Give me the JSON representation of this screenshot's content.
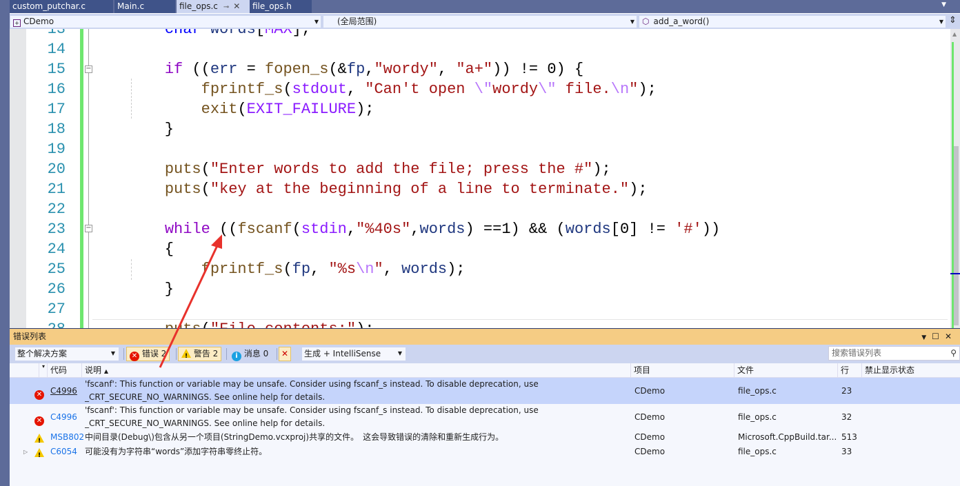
{
  "tabs": [
    {
      "label": "custom_putchar.c"
    },
    {
      "label": "Main.c"
    },
    {
      "label": "file_ops.c",
      "active": true
    },
    {
      "label": "file_ops.h"
    }
  ],
  "nav": {
    "project": "CDemo",
    "scope": "(全局范围)",
    "function": "add_a_word()"
  },
  "code": [
    {
      "n": "13",
      "t": [
        [
          "    ",
          "pl"
        ],
        [
          "char",
          "ty"
        ],
        [
          " ",
          "pl"
        ],
        [
          "words",
          "var"
        ],
        [
          "[",
          "pl"
        ],
        [
          "MAX",
          "mac"
        ],
        [
          "];",
          "pl"
        ]
      ]
    },
    {
      "n": "14",
      "t": []
    },
    {
      "n": "15",
      "t": [
        [
          "    ",
          "pl"
        ],
        [
          "if",
          "kw"
        ],
        [
          " ((",
          "pl"
        ],
        [
          "err",
          "var"
        ],
        [
          " = ",
          "pl"
        ],
        [
          "fopen_s",
          "fn"
        ],
        [
          "(&",
          "pl"
        ],
        [
          "fp",
          "var"
        ],
        [
          ",",
          "pl"
        ],
        [
          "\"wordy\"",
          "str"
        ],
        [
          ", ",
          "pl"
        ],
        [
          "\"a+\"",
          "str"
        ],
        [
          ")) != 0) {",
          "pl"
        ]
      ]
    },
    {
      "n": "16",
      "t": [
        [
          "        ",
          "pl"
        ],
        [
          "fprintf_s",
          "fn"
        ],
        [
          "(",
          "pl"
        ],
        [
          "stdout",
          "mac"
        ],
        [
          ", ",
          "pl"
        ],
        [
          "\"Can't open ",
          "str"
        ],
        [
          "\\\"",
          "esc"
        ],
        [
          "wordy",
          "str"
        ],
        [
          "\\\"",
          "esc"
        ],
        [
          " file.",
          "str"
        ],
        [
          "\\n",
          "esc"
        ],
        [
          "\"",
          "str"
        ],
        [
          ");",
          "pl"
        ]
      ]
    },
    {
      "n": "17",
      "t": [
        [
          "        ",
          "pl"
        ],
        [
          "exit",
          "fn"
        ],
        [
          "(",
          "pl"
        ],
        [
          "EXIT_FAILURE",
          "mac"
        ],
        [
          ");",
          "pl"
        ]
      ]
    },
    {
      "n": "18",
      "t": [
        [
          "    }",
          "pl"
        ]
      ]
    },
    {
      "n": "19",
      "t": []
    },
    {
      "n": "20",
      "t": [
        [
          "    ",
          "pl"
        ],
        [
          "puts",
          "fn"
        ],
        [
          "(",
          "pl"
        ],
        [
          "\"Enter words to add the file; press the #\"",
          "str"
        ],
        [
          ");",
          "pl"
        ]
      ]
    },
    {
      "n": "21",
      "t": [
        [
          "    ",
          "pl"
        ],
        [
          "puts",
          "fn"
        ],
        [
          "(",
          "pl"
        ],
        [
          "\"key at the beginning of a line to terminate.\"",
          "str"
        ],
        [
          ");",
          "pl"
        ]
      ]
    },
    {
      "n": "22",
      "t": []
    },
    {
      "n": "23",
      "t": [
        [
          "    ",
          "pl"
        ],
        [
          "while",
          "kw"
        ],
        [
          " ((",
          "pl"
        ],
        [
          "fscanf",
          "fn"
        ],
        [
          "(",
          "pl"
        ],
        [
          "stdin",
          "mac"
        ],
        [
          ",",
          "pl"
        ],
        [
          "\"%40s\"",
          "str"
        ],
        [
          ",",
          "pl"
        ],
        [
          "words",
          "var"
        ],
        [
          ") ==1) && (",
          "pl"
        ],
        [
          "words",
          "var"
        ],
        [
          "[0] != ",
          "pl"
        ],
        [
          "'#'",
          "str"
        ],
        [
          "))",
          "pl"
        ]
      ]
    },
    {
      "n": "24",
      "t": [
        [
          "    {",
          "pl"
        ]
      ]
    },
    {
      "n": "25",
      "t": [
        [
          "        ",
          "pl"
        ],
        [
          "fprintf_s",
          "fn"
        ],
        [
          "(",
          "pl"
        ],
        [
          "fp",
          "var"
        ],
        [
          ", ",
          "pl"
        ],
        [
          "\"%s",
          "str"
        ],
        [
          "\\n",
          "esc"
        ],
        [
          "\"",
          "str"
        ],
        [
          ", ",
          "pl"
        ],
        [
          "words",
          "var"
        ],
        [
          ");",
          "pl"
        ]
      ]
    },
    {
      "n": "26",
      "t": [
        [
          "    }",
          "pl"
        ]
      ]
    },
    {
      "n": "27",
      "t": []
    },
    {
      "n": "28",
      "t": [
        [
          "    ",
          "pl"
        ],
        [
          "puts",
          "fn"
        ],
        [
          "(",
          "pl"
        ],
        [
          "\"File contents:\"",
          "str"
        ],
        [
          ");",
          "pl"
        ]
      ]
    }
  ],
  "error_list": {
    "title": "错误列表",
    "scope": "整个解决方案",
    "errors": "错误 2",
    "warnings": "警告 2",
    "messages": "消息 0",
    "source": "生成 + IntelliSense",
    "search_placeholder": "搜索错误列表",
    "columns": {
      "code": "代码",
      "desc": "说明",
      "project": "项目",
      "file": "文件",
      "line": "行",
      "suppress": "禁止显示状态"
    },
    "rows": [
      {
        "severity": "error",
        "code": "C4996",
        "desc1": "'fscanf': This function or variable may be unsafe. Consider using fscanf_s instead. To disable deprecation, use",
        "desc2": "_CRT_SECURE_NO_WARNINGS. See online help for details.",
        "project": "CDemo",
        "file": "file_ops.c",
        "line": "23",
        "selected": true
      },
      {
        "severity": "error",
        "code": "C4996",
        "desc1": "'fscanf': This function or variable may be unsafe. Consider using fscanf_s instead. To disable deprecation, use",
        "desc2": "_CRT_SECURE_NO_WARNINGS. See online help for details.",
        "project": "CDemo",
        "file": "file_ops.c",
        "line": "32"
      },
      {
        "severity": "warning",
        "code": "MSB802",
        "desc1": "中间目录(Debug\\)包含从另一个项目(StringDemo.vcxproj)共享的文件。　这会导致错误的清除和重新生成行为。",
        "project": "CDemo",
        "file": "Microsoft.CppBuild.tar...",
        "line": "513"
      },
      {
        "severity": "warning",
        "code": "C6054",
        "desc1": "可能没有为字符串“words”添加字符串零终止符。",
        "project": "CDemo",
        "file": "file_ops.c",
        "line": "33",
        "expandable": true
      }
    ]
  },
  "colors": {
    "accent": "#f5cc84",
    "selected_row": "#c5d4fb",
    "annotation_arrow": "#e8322c"
  }
}
